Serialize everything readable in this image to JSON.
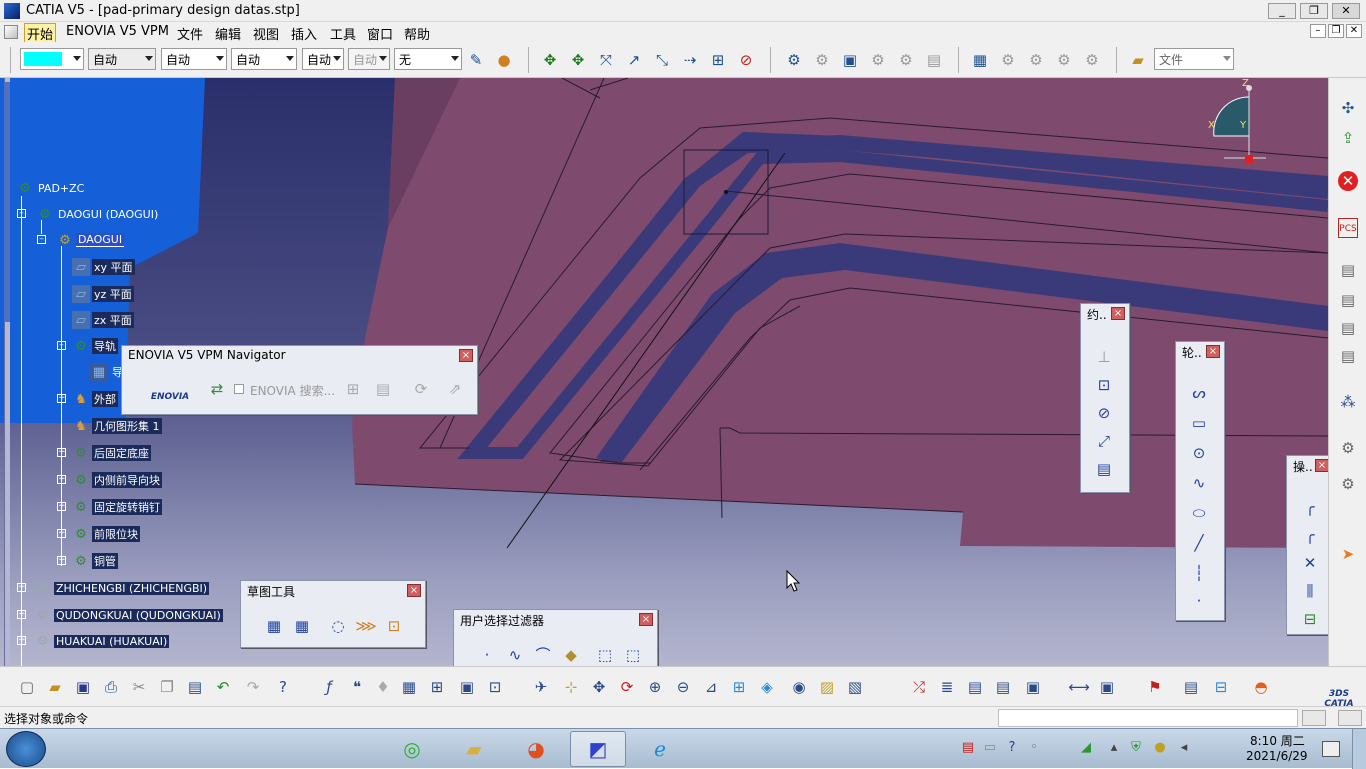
{
  "window": {
    "title": "CATIA V5 - [pad-primary design datas.stp]",
    "btn_min": "_",
    "btn_max": "❐",
    "btn_close": "✕"
  },
  "menu": {
    "items": [
      "开始",
      "ENOVIA V5 VPM",
      "文件",
      "编辑",
      "视图",
      "插入",
      "工具",
      "窗口",
      "帮助"
    ],
    "doc_min": "–",
    "doc_restore": "❐",
    "doc_close": "✕"
  },
  "toolbar": {
    "color": "#00ffff",
    "combo_linetype": "自动",
    "combo_thickness": "自动",
    "combo_style": "自动",
    "combo_layer": "自动",
    "combo_layer_short": "自动",
    "combo_none": "无",
    "combo_file": "文件"
  },
  "tree": {
    "root": "PAD+ZC",
    "daogui_node": "DAOGUI (DAOGUI)",
    "daogui_part": "DAOGUI",
    "xy": "xy 平面",
    "yz": "yz 平面",
    "zx": "zx 平面",
    "rail": "导轨",
    "rail_child": "导",
    "outer": "外部",
    "geoset": "几何图形集 1",
    "rear_base": "后固定底座",
    "inner_guide": "内侧前导向块",
    "fixed_pin": "固定旋转销钉",
    "front_stop": "前限位块",
    "copper_tube": "铜管",
    "zhichengbi": "ZHICHENGBI (ZHICHENGBI)",
    "qudongkuai": "QUDONGKUAI (QUDONGKUAI)",
    "huakuai": "HUAKUAI (HUAKUAI)"
  },
  "panels": {
    "enovia": {
      "title": "ENOVIA V5 VPM Navigator",
      "logo": "ENOVIA",
      "search": "ENOVIA 搜索..."
    },
    "sketch_tools": {
      "title": "草图工具"
    },
    "user_filter": {
      "title": "用户选择过滤器"
    },
    "constraint": {
      "title": "约.."
    },
    "profile": {
      "title": "轮.."
    },
    "operation": {
      "title": "操.."
    }
  },
  "compass": {
    "z": "Z",
    "x": "X",
    "y": "Y"
  },
  "status": {
    "text": "选择对象或命令"
  },
  "taskbar": {
    "time": "8:10 周二",
    "date": "2021/6/29"
  },
  "colors": {
    "viewport_top": "#2a2e6a",
    "part_face": "#7e4b6e",
    "groove": "#3a3a7a",
    "tree_bg": "#1560d8"
  }
}
